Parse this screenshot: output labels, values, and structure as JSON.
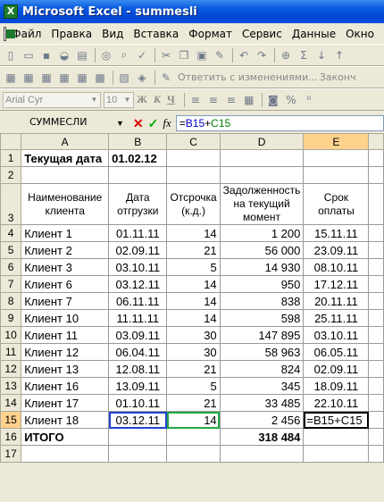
{
  "window": {
    "title": "Microsoft Excel - summesli"
  },
  "menu": [
    "Файл",
    "Правка",
    "Вид",
    "Вставка",
    "Формат",
    "Сервис",
    "Данные",
    "Окно"
  ],
  "toolbar_review": {
    "reply_text": "Ответить с изменениями...",
    "end_text": "Законч"
  },
  "format_toolbar": {
    "font_name": "Arial Cyr",
    "font_size": "10",
    "bold": "Ж",
    "italic": "К",
    "underline": "Ч"
  },
  "formula_bar": {
    "name_box": "СУММЕСЛИ",
    "formula_prefix": "=",
    "ref_b": "B15",
    "op": "+",
    "ref_c": "C15"
  },
  "columns": [
    "A",
    "B",
    "C",
    "D",
    "E"
  ],
  "row_numbers": [
    "1",
    "2",
    "3",
    "4",
    "5",
    "6",
    "7",
    "8",
    "9",
    "10",
    "11",
    "12",
    "13",
    "14",
    "15",
    "16",
    "17"
  ],
  "sheet": {
    "a1": "Текущая дата",
    "b1": "01.02.12",
    "headers": {
      "client": "Наименование клиента",
      "ship_date": "Дата отгрузки",
      "delay": "Отсрочка (к.д.)",
      "debt": "Задолженность на текущий момент",
      "due": "Срок оплаты"
    },
    "rows": [
      {
        "client": "Клиент 1",
        "date": "01.11.11",
        "delay": "14",
        "debt": "1 200",
        "due": "15.11.11"
      },
      {
        "client": "Клиент 2",
        "date": "02.09.11",
        "delay": "21",
        "debt": "56 000",
        "due": "23.09.11"
      },
      {
        "client": "Клиент 3",
        "date": "03.10.11",
        "delay": "5",
        "debt": "14 930",
        "due": "08.10.11"
      },
      {
        "client": "Клиент 6",
        "date": "03.12.11",
        "delay": "14",
        "debt": "950",
        "due": "17.12.11"
      },
      {
        "client": "Клиент 7",
        "date": "06.11.11",
        "delay": "14",
        "debt": "838",
        "due": "20.11.11"
      },
      {
        "client": "Клиент 10",
        "date": "11.11.11",
        "delay": "14",
        "debt": "598",
        "due": "25.11.11"
      },
      {
        "client": "Клиент 11",
        "date": "03.09.11",
        "delay": "30",
        "debt": "147 895",
        "due": "03.10.11"
      },
      {
        "client": "Клиент 12",
        "date": "06.04.11",
        "delay": "30",
        "debt": "58 963",
        "due": "06.05.11"
      },
      {
        "client": "Клиент 13",
        "date": "12.08.11",
        "delay": "21",
        "debt": "824",
        "due": "02.09.11"
      },
      {
        "client": "Клиент 16",
        "date": "13.09.11",
        "delay": "5",
        "debt": "345",
        "due": "18.09.11"
      },
      {
        "client": "Клиент 17",
        "date": "01.10.11",
        "delay": "21",
        "debt": "33 485",
        "due": "22.10.11"
      },
      {
        "client": "Клиент 18",
        "date": "03.12.11",
        "delay": "14",
        "debt": "2 456",
        "due": "=B15+C15"
      }
    ],
    "total_label": "ИТОГО",
    "total_value": "318 484"
  },
  "colors": {
    "title_bar": "#0A5BE0",
    "selection_header": "#FFD28E",
    "ref_blue": "#2244CC",
    "ref_green": "#22AA44"
  }
}
